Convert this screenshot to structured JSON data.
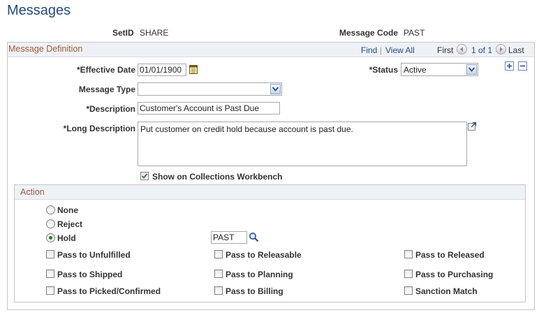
{
  "page": {
    "title": "Messages"
  },
  "keys": {
    "setid_label": "SetID",
    "setid_value": "SHARE",
    "message_code_label": "Message Code",
    "message_code_value": "PAST"
  },
  "definition": {
    "title": "Message Definition",
    "find": "Find",
    "separator": "|",
    "view_all": "View All",
    "first": "First",
    "pager": "1 of 1",
    "last": "Last",
    "effective_date_label": "*Effective Date",
    "effective_date_value": "01/01/1900",
    "status_label": "*Status",
    "status_value": "Active",
    "message_type_label": "Message Type",
    "message_type_value": "",
    "description_label": "*Description",
    "description_value": "Customer's Account is Past Due",
    "long_description_label": "*Long Description",
    "long_description_value": "Put customer on credit hold because account is past due.",
    "show_workbench_label": "Show on Collections Workbench",
    "show_workbench_checked": true
  },
  "action": {
    "title": "Action",
    "radios": [
      {
        "label": "None",
        "selected": false
      },
      {
        "label": "Reject",
        "selected": false
      },
      {
        "label": "Hold",
        "selected": true
      }
    ],
    "hold_code": "PAST",
    "checkboxes": [
      {
        "label": "Pass to Unfulfilled",
        "checked": false
      },
      {
        "label": "Pass to Releasable",
        "checked": false
      },
      {
        "label": "Pass to Released",
        "checked": false
      },
      {
        "label": "Pass to Shipped",
        "checked": false
      },
      {
        "label": "Pass to Planning",
        "checked": false
      },
      {
        "label": "Pass to Purchasing",
        "checked": false
      },
      {
        "label": "Pass to Picked/Confirmed",
        "checked": false
      },
      {
        "label": "Pass to Billing",
        "checked": false
      },
      {
        "label": "Sanction Match",
        "checked": false
      }
    ]
  },
  "colors": {
    "title": "#254a7f",
    "section_title": "#a25a3a",
    "header_bg": "#eef2f7",
    "check_green": "#2a7a2a"
  }
}
